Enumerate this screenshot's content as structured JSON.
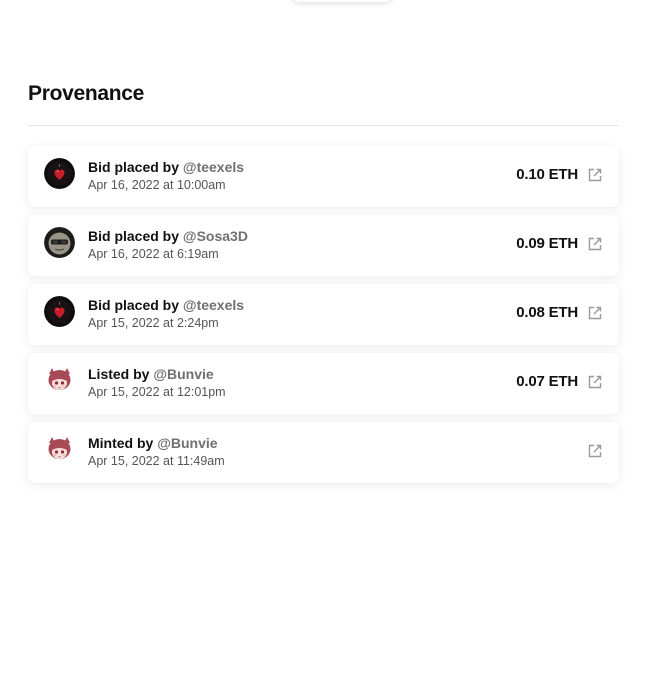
{
  "section": {
    "title": "Provenance"
  },
  "history": [
    {
      "action": "Bid placed by",
      "user": "@teexels",
      "date": "Apr 16, 2022 at 10:00am",
      "price": "0.10 ETH",
      "avatar_icon": "red-heart-avatar-icon"
    },
    {
      "action": "Bid placed by",
      "user": "@Sosa3D",
      "date": "Apr 16, 2022 at 6:19am",
      "price": "0.09 ETH",
      "avatar_icon": "sunglasses-avatar-icon"
    },
    {
      "action": "Bid placed by",
      "user": "@teexels",
      "date": "Apr 15, 2022 at 2:24pm",
      "price": "0.08 ETH",
      "avatar_icon": "red-heart-avatar-icon"
    },
    {
      "action": "Listed by",
      "user": "@Bunvie",
      "date": "Apr 15, 2022 at 12:01pm",
      "price": "0.07 ETH",
      "avatar_icon": "anime-girl-avatar-icon"
    },
    {
      "action": "Minted by",
      "user": "@Bunvie",
      "date": "Apr 15, 2022 at 11:49am",
      "price": "",
      "avatar_icon": "anime-girl-avatar-icon"
    }
  ],
  "colors": {
    "text_primary": "#111111",
    "username": "#707070",
    "date": "#555555",
    "icon": "#9a9a9a"
  }
}
